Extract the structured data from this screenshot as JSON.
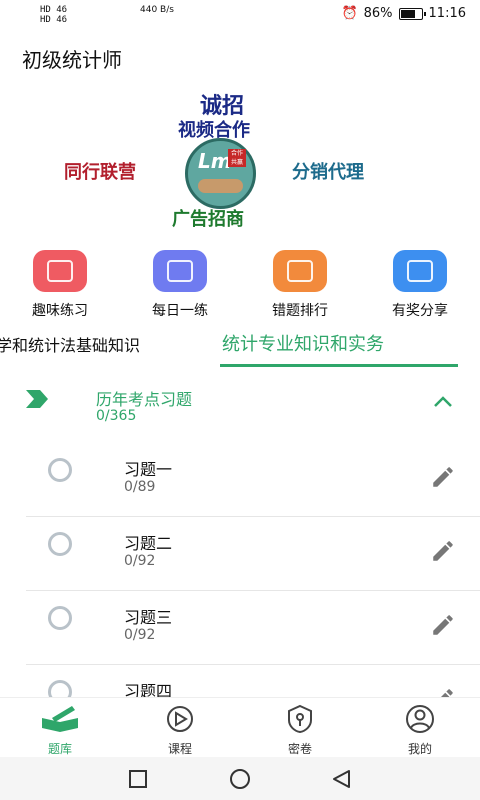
{
  "status_bar": {
    "left_indicators": [
      "HD 46",
      "HD 46",
      "440 B/s"
    ],
    "battery": "86%",
    "battery_level": 0.86,
    "time": "11:16"
  },
  "app": {
    "title": "初级统计师"
  },
  "banner": {
    "top_line1": "诚招",
    "top_line2": "视频合作",
    "left": "同行联营",
    "right": "分销代理",
    "bottom": "广告招商",
    "logo_text": "Lm",
    "seal_text": "合作 共赢"
  },
  "quick_actions": [
    {
      "label": "趣味练习",
      "icon": "practice-icon",
      "color": "#ef5b62"
    },
    {
      "label": "每日一练",
      "icon": "daily-icon",
      "color": "#6f7bf0"
    },
    {
      "label": "错题排行",
      "icon": "ranking-icon",
      "color": "#f28a3c"
    },
    {
      "label": "有奖分享",
      "icon": "share-icon",
      "color": "#3d8ff0"
    }
  ],
  "tabs": {
    "left": "学和统计法基础知识",
    "right": "统计专业知识和实务",
    "accent": "#2fa66a"
  },
  "chapter": {
    "title": "历年考点习题",
    "count": "0/365"
  },
  "items": [
    {
      "title": "习题一",
      "count": "0/89"
    },
    {
      "title": "习题二",
      "count": "0/92"
    },
    {
      "title": "习题三",
      "count": "0/92"
    },
    {
      "title": "习题四",
      "count": ""
    }
  ],
  "bottom_nav": [
    {
      "label": "题库",
      "icon": "question-bank-icon",
      "active": true
    },
    {
      "label": "课程",
      "icon": "play-course-icon",
      "active": false
    },
    {
      "label": "密卷",
      "icon": "lock-paper-icon",
      "active": false
    },
    {
      "label": "我的",
      "icon": "profile-icon",
      "active": false
    }
  ]
}
